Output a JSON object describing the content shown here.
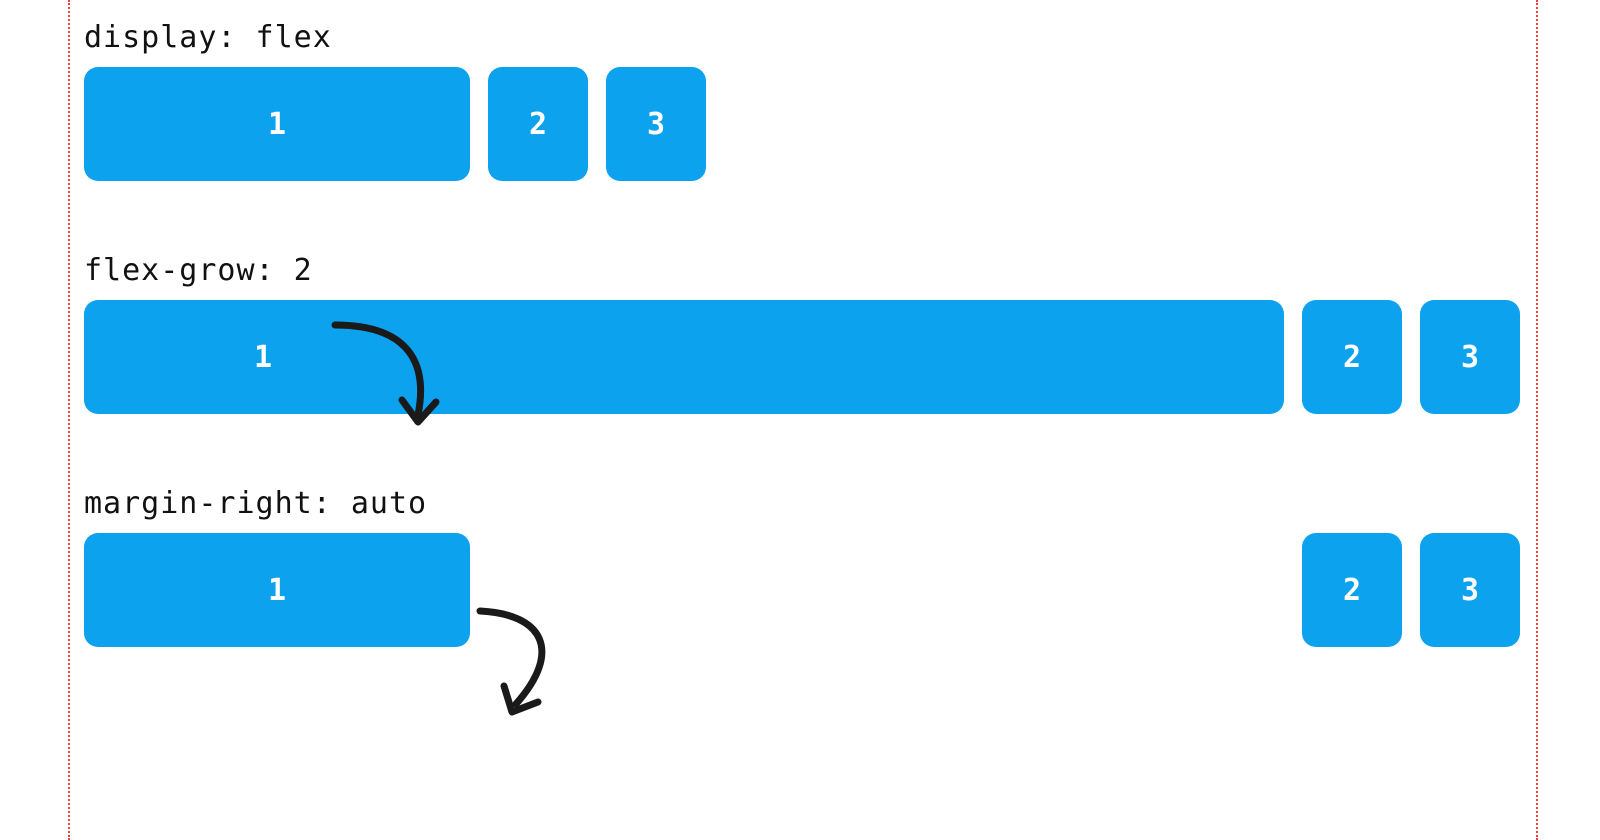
{
  "colors": {
    "box": "#0DA2EE",
    "guide": "#EE4444",
    "text": "#111111",
    "boxText": "#FFFFFF"
  },
  "examples": [
    {
      "label": "display: flex",
      "boxes": [
        "1",
        "2",
        "3"
      ]
    },
    {
      "label": "flex-grow: 2",
      "boxes": [
        "1",
        "2",
        "3"
      ]
    },
    {
      "label": "margin-right: auto",
      "boxes": [
        "1",
        "2",
        "3"
      ]
    }
  ]
}
